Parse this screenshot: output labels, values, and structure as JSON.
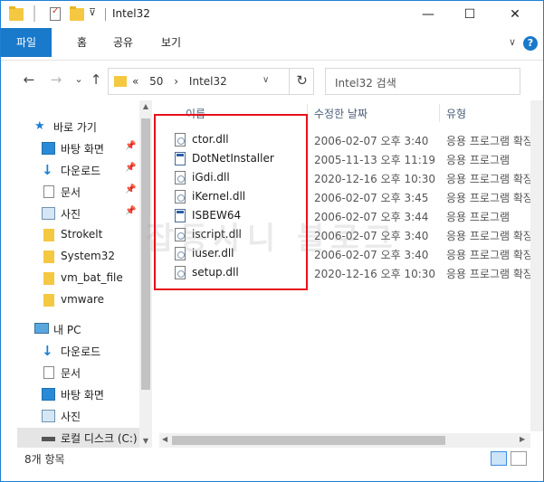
{
  "title_bar": {
    "title": "Intel32",
    "minimize": "—",
    "maximize": "☐",
    "close": "✕"
  },
  "ribbon": {
    "tabs": [
      "파일",
      "홈",
      "공유",
      "보기"
    ],
    "help": "?"
  },
  "navbar": {
    "back": "←",
    "forward": "→",
    "recent": "⌄",
    "up": "↑",
    "address": {
      "prefix": "«",
      "crumbs": [
        "50",
        "›",
        "Intel32"
      ],
      "dropdown": "∨"
    },
    "refresh": "↻",
    "search_placeholder": "Intel32 검색"
  },
  "nav_pane": {
    "quick_access": "바로 가기",
    "items": [
      {
        "label": "바탕 화면",
        "icon": "desktop-icon",
        "pinned": true
      },
      {
        "label": "다운로드",
        "icon": "download-icon",
        "pinned": true
      },
      {
        "label": "문서",
        "icon": "document-icon",
        "pinned": true
      },
      {
        "label": "사진",
        "icon": "picture-icon",
        "pinned": true
      },
      {
        "label": "Strokelt",
        "icon": "folder-icon",
        "pinned": false
      },
      {
        "label": "System32",
        "icon": "folder-icon",
        "pinned": false
      },
      {
        "label": "vm_bat_file",
        "icon": "folder-icon",
        "pinned": false
      },
      {
        "label": "vmware",
        "icon": "folder-icon",
        "pinned": false
      }
    ],
    "this_pc": "내 PC",
    "pc_items": [
      {
        "label": "다운로드",
        "icon": "download-icon"
      },
      {
        "label": "문서",
        "icon": "document-icon"
      },
      {
        "label": "바탕 화면",
        "icon": "desktop-icon"
      },
      {
        "label": "사진",
        "icon": "picture-icon"
      },
      {
        "label": "로컬 디스크 (C:)",
        "icon": "disk-icon"
      }
    ]
  },
  "file_list": {
    "columns": {
      "name": "이름",
      "date": "수정한 날짜",
      "type": "유형"
    },
    "files": [
      {
        "name": "ctor.dll",
        "date": "2006-02-07 오후 3:40",
        "type": "응용 프로그램 확장",
        "kind": "dll"
      },
      {
        "name": "DotNetInstaller",
        "date": "2005-11-13 오후 11:19",
        "type": "응용 프로그램",
        "kind": "exe"
      },
      {
        "name": "iGdi.dll",
        "date": "2020-12-16 오후 10:30",
        "type": "응용 프로그램 확장",
        "kind": "dll"
      },
      {
        "name": "iKernel.dll",
        "date": "2006-02-07 오후 3:45",
        "type": "응용 프로그램 확장",
        "kind": "dll"
      },
      {
        "name": "ISBEW64",
        "date": "2006-02-07 오후 3:44",
        "type": "응용 프로그램",
        "kind": "exe"
      },
      {
        "name": "iscript.dll",
        "date": "2006-02-07 오후 3:40",
        "type": "응용 프로그램 확장",
        "kind": "dll"
      },
      {
        "name": "iuser.dll",
        "date": "2006-02-07 오후 3:40",
        "type": "응용 프로그램 확장",
        "kind": "dll"
      },
      {
        "name": "setup.dll",
        "date": "2020-12-16 오후 10:30",
        "type": "응용 프로그램 확장",
        "kind": "dll"
      }
    ]
  },
  "watermark": "잡동사니 블로그",
  "status": {
    "count": "8개 항목"
  },
  "colors": {
    "accent": "#1979ca",
    "highlight_box": "#e8101a",
    "folder": "#f5c842"
  }
}
